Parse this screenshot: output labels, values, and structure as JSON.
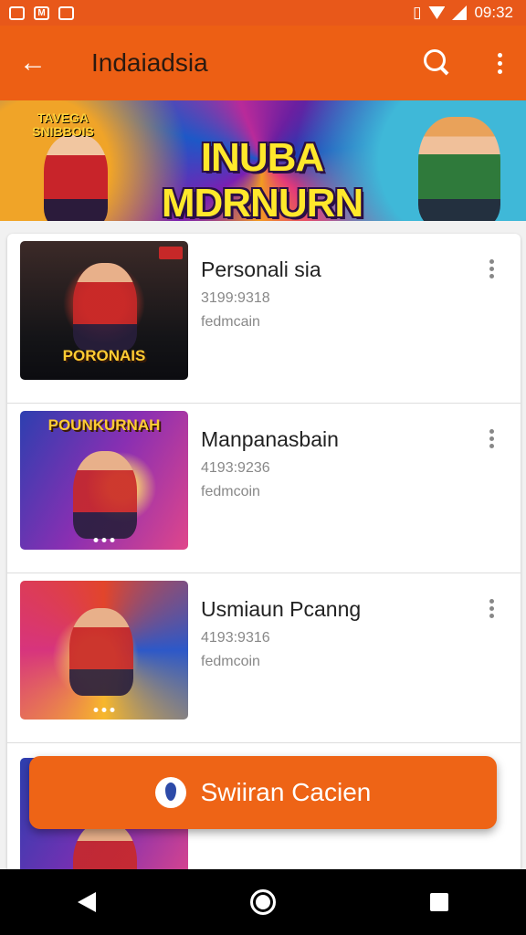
{
  "status_bar": {
    "time": "09:32",
    "icons": [
      "app-icon",
      "gmail-icon",
      "camera-icon",
      "vibrate-icon",
      "wifi-icon",
      "signal-icon"
    ]
  },
  "app_bar": {
    "title": "Indaiadsia",
    "back_icon": "arrow-left-icon",
    "search_icon": "search-icon",
    "overflow_icon": "more-vert-icon"
  },
  "banner": {
    "title": "INUBA MDRNURN",
    "subtitle": "TAVEGA SNIBBOIS"
  },
  "list": {
    "items": [
      {
        "title": "Personali sia",
        "meta1": "3199:9318",
        "meta2": "fedmcain",
        "thumb_text": "PORONAIS"
      },
      {
        "title": "Manpanasbain",
        "meta1": "4193:9236",
        "meta2": "fedmcoin",
        "thumb_text": "POUNKURNAH"
      },
      {
        "title": "Usmiaun Pcanng",
        "meta1": "4193:9316",
        "meta2": "fedmcoin",
        "thumb_text": ""
      },
      {
        "title": "",
        "meta1": "",
        "meta2": "",
        "thumb_text": ""
      }
    ]
  },
  "fab": {
    "label": "Swiiran Cacien",
    "icon": "drop-icon"
  },
  "nav_bar": {
    "back_icon": "nav-back-icon",
    "home_icon": "nav-home-icon",
    "recents_icon": "nav-recents-icon"
  },
  "colors": {
    "accent": "#ED5F14",
    "fab": "#EE6416"
  }
}
